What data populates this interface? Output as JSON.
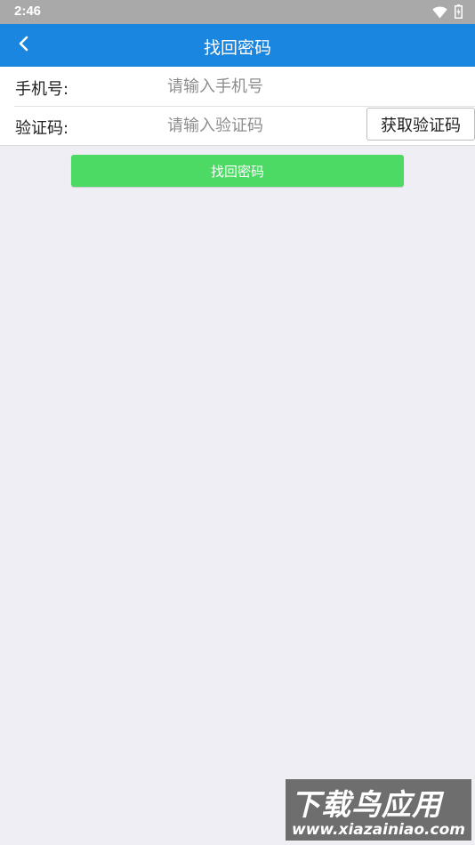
{
  "status_bar": {
    "time": "2:46",
    "icons": [
      "wifi-icon",
      "battery-icon"
    ]
  },
  "app_bar": {
    "title": "找回密码",
    "back_icon": "chevron-left-icon",
    "color": "#1a86e0"
  },
  "form": {
    "phone": {
      "label": "手机号:",
      "placeholder": "请输入手机号",
      "value": ""
    },
    "code": {
      "label": "验证码:",
      "placeholder": "请输入验证码",
      "value": "",
      "button_label": "获取验证码"
    }
  },
  "submit": {
    "label": "找回密码",
    "color": "#4cd964"
  },
  "watermark": {
    "title": "下载鸟应用",
    "url": "www.xiazainiao.com"
  }
}
